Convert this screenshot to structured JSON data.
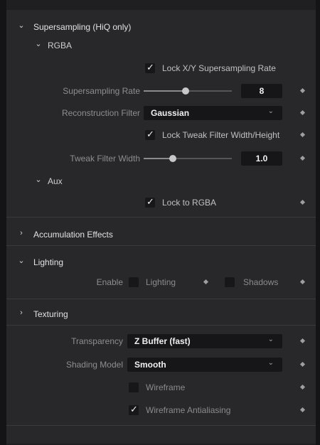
{
  "supersampling": {
    "title": "Supersampling (HiQ only)",
    "rgba_title": "RGBA",
    "lock_xy_label": "Lock X/Y Supersampling Rate",
    "lock_xy_checked": true,
    "rate_label": "Supersampling Rate",
    "rate_value": "8",
    "rate_slider_fraction": 0.45,
    "recon_label": "Reconstruction Filter",
    "recon_value": "Gaussian",
    "lock_tweak_label": "Lock Tweak Filter Width/Height",
    "lock_tweak_checked": true,
    "tweak_label": "Tweak Filter Width",
    "tweak_value": "1.0",
    "tweak_slider_fraction": 0.3,
    "aux_title": "Aux",
    "lock_rgba_label": "Lock to RGBA",
    "lock_rgba_checked": true
  },
  "accumulation": {
    "title": "Accumulation Effects"
  },
  "lighting": {
    "title": "Lighting",
    "enable_label": "Enable",
    "lighting_label": "Lighting",
    "lighting_checked": false,
    "shadows_label": "Shadows",
    "shadows_checked": false
  },
  "texturing": {
    "title": "Texturing"
  },
  "render": {
    "transparency_label": "Transparency",
    "transparency_value": "Z Buffer (fast)",
    "shading_label": "Shading Model",
    "shading_value": "Smooth",
    "wireframe_label": "Wireframe",
    "wireframe_checked": false,
    "wire_aa_label": "Wireframe Antialiasing",
    "wire_aa_checked": true
  },
  "icons": {
    "expanded": "chevron-down-icon",
    "collapsed": "chevron-right-icon",
    "keyframe": "keyframe-diamond-icon",
    "check": "checkmark-icon"
  }
}
